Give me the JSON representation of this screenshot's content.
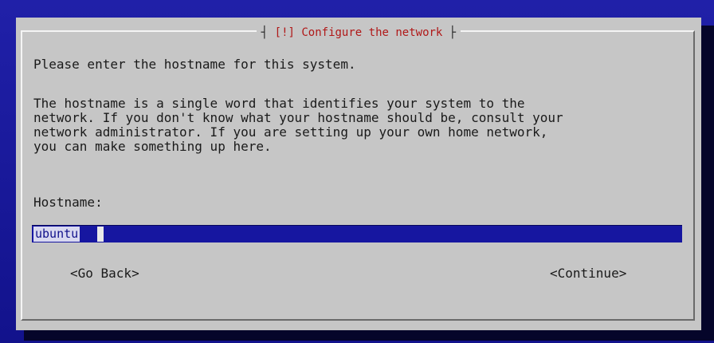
{
  "dialog": {
    "title_left_bracket": "┤",
    "title_text": "[!] Configure the network",
    "title_right_bracket": "├",
    "prompt": "Please enter the hostname for this system.",
    "description": "The hostname is a single word that identifies your system to the\nnetwork. If you don't know what your hostname should be, consult your\nnetwork administrator. If you are setting up your own home network,\nyou can make something up here.",
    "hostname_label": "Hostname:",
    "hostname_value": "ubuntu",
    "go_back_label": "<Go Back>",
    "continue_label": "<Continue>"
  },
  "colors": {
    "background": "#1a1a9a",
    "dialog": "#c6c6c6",
    "title": "#b01818",
    "input": "#1616a0"
  }
}
